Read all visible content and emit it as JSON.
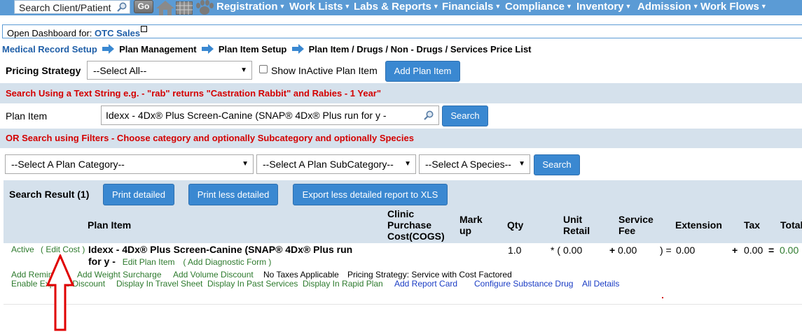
{
  "topnav": {
    "search_placeholder": "Search Client/Patient",
    "go_label": "Go",
    "items": [
      "Registration",
      "Work Lists",
      "Labs & Reports",
      "Financials",
      "Compliance",
      "Inventory",
      "Admission",
      "Work Flows"
    ]
  },
  "dashboard": {
    "label": "Open Dashboard for:",
    "value": "OTC Sales"
  },
  "breadcrumb": [
    "Medical Record Setup",
    "Plan Management",
    "Plan Item Setup",
    "Plan Item / Drugs / Non - Drugs / Services Price List"
  ],
  "filters": {
    "pricing_strategy_label": "Pricing Strategy",
    "pricing_strategy_value": "--Select All--",
    "show_inactive_label": "Show InActive Plan Item",
    "add_plan_item": "Add Plan Item",
    "text_search_hint": "Search Using a Text String e.g. - \"rab\" returns \"Castration Rabbit\" and Rabies - 1 Year\"",
    "plan_item_label": "Plan Item",
    "plan_item_value": "Idexx - 4Dx® Plus Screen-Canine (SNAP® 4Dx® Plus run for y -",
    "search_button": "Search",
    "filter_hint": "OR Search using Filters - Choose category and optionally Subcategory and optionally Species",
    "category_value": "--Select A Plan Category--",
    "subcategory_value": "--Select A Plan SubCategory--",
    "species_value": "--Select A Species--",
    "search_button_2": "Search"
  },
  "results": {
    "title": "Search Result (1)",
    "print_detailed": "Print detailed",
    "print_less": "Print less detailed",
    "export_xls": "Export less detailed report to XLS",
    "columns": {
      "plan_item": "Plan Item",
      "cogs_1": "Clinic",
      "cogs_2": "Purchase",
      "cogs_3": "Cost(COGS)",
      "markup_1": "Mark",
      "markup_2": "up",
      "qty": "Qty",
      "unit_retail_1": "Unit",
      "unit_retail_2": "Retail",
      "service_fee_1": "Service",
      "service_fee_2": "Fee",
      "extension": "Extension",
      "tax": "Tax",
      "total": "Total"
    },
    "row": {
      "status": "Active",
      "edit_cost": "( Edit Cost )",
      "name_line1": "Idexx - 4Dx® Plus Screen-Canine (SNAP® 4Dx® Plus run",
      "name_line2": "for y -",
      "edit_plan_item": "Edit Plan Item",
      "add_diagnostic": "( Add Diagnostic Form )",
      "qty": "1.0",
      "unit_prefix": "* (",
      "unit_retail": "0.00",
      "fee_prefix": "+",
      "service_fee": "0.00",
      "ext_prefix": ") =",
      "extension": "0.00",
      "tax_prefix": "+",
      "tax": "0.00",
      "total_prefix": "=",
      "total": "0.00"
    },
    "links_row1": [
      "Add Reminder",
      "Add Weight Surcharge",
      "Add Volume Discount"
    ],
    "no_taxes": "No Taxes Applicable",
    "pricing_strategy_text": "Pricing Strategy: Service with Cost Factored",
    "links_row2_green": [
      "Enable Express Discount",
      "Display In Travel Sheet",
      "Display In Past Services",
      "Display In Rapid Plan"
    ],
    "links_row2_blue": [
      "Add Report Card",
      "Configure Substance Drug",
      "All Details"
    ]
  },
  "colors": {
    "nav": "#5b9bd5",
    "band": "#d5e1ec",
    "button": "#3a88d1",
    "red_hint": "#d40000",
    "link_green": "#2d7a2d",
    "annotation_arrow": "#e00000"
  }
}
